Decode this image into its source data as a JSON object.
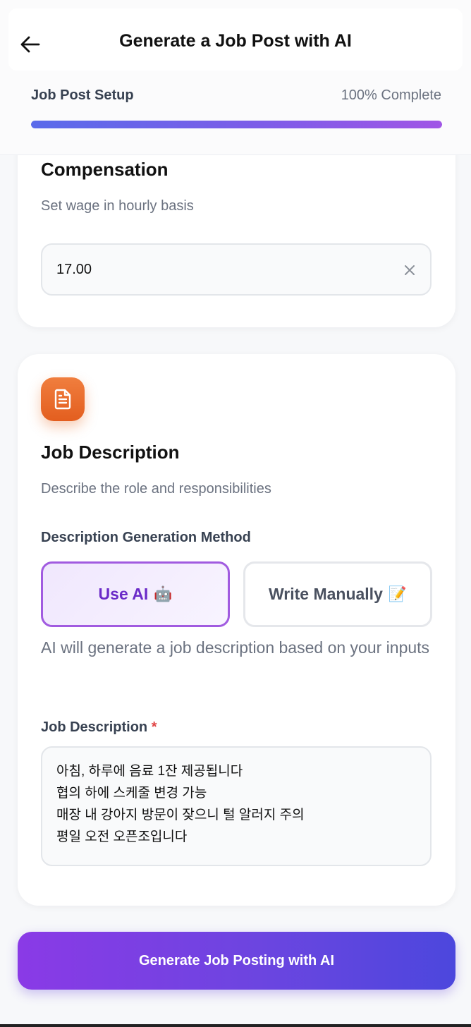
{
  "header": {
    "title": "Generate a Job Post with AI",
    "back_icon": "arrow-left-icon"
  },
  "progress": {
    "label": "Job Post Setup",
    "percent_text": "100% Complete",
    "value": 1.0,
    "gradient_colors": [
      "#5a6bea",
      "#a056e6"
    ]
  },
  "compensation": {
    "title": "Compensation",
    "subtitle": "Set wage in hourly basis",
    "wage_value": "17.00",
    "clear_icon": "close-icon"
  },
  "job_description": {
    "icon": "document-icon",
    "icon_color": "#e8682a",
    "title": "Job Description",
    "subtitle": "Describe the role and responsibilities",
    "method_label": "Description Generation Method",
    "methods": [
      {
        "label": "Use AI",
        "emoji": "🤖",
        "selected": true
      },
      {
        "label": "Write Manually",
        "emoji": "📝",
        "selected": false
      }
    ],
    "helper_text": "AI will generate a job description based on your inputs",
    "field_label": "Job Description",
    "required_mark": "*",
    "lines": [
      "아침, 하루에 음료 1잔 제공됩니다",
      "협의 하에 스케줄 변경 가능",
      "매장 내 강아지 방문이 잦으니 털 알러지 주의",
      "평일 오전 오픈조입니다"
    ]
  },
  "cta": {
    "label": "Generate Job Posting with AI",
    "gradient_colors": [
      "#8a3ae6",
      "#4c47dd"
    ]
  }
}
